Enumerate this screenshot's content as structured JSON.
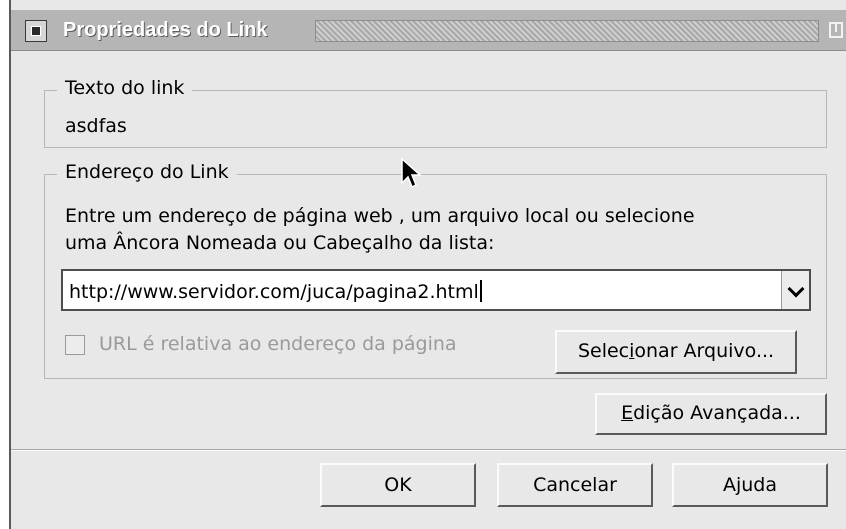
{
  "window": {
    "title": "Propriedades do Link"
  },
  "icons": {
    "menu": "window-menu-icon",
    "maximize": "maximize-icon",
    "dropdown": "chevron-down-icon",
    "cursor": "mouse-cursor-icon"
  },
  "link_text_group": {
    "legend": "Texto do link",
    "value": "asdfas"
  },
  "address_group": {
    "legend": "Endereço do Link",
    "description_line1": "Entre um endereço de página web , um arquivo local ou selecione",
    "description_line2": "uma Âncora Nomeada ou Cabeçalho da lista:",
    "url_value": "http://www.servidor.com/juca/pagina2.html",
    "relative_checkbox": {
      "label": "URL é relativa ao endereço da página",
      "checked": false,
      "disabled": true
    },
    "select_file_button": {
      "before": "Selec",
      "accel": "i",
      "after": "onar Arquivo..."
    }
  },
  "advanced_button": {
    "accel": "E",
    "after": "dição Avançada..."
  },
  "buttons": {
    "ok": "OK",
    "cancel": "Cancelar",
    "help": "Ajuda"
  },
  "colors": {
    "dialog_bg": "#e8e8e8",
    "titlebar_bg": "#b5b5b5",
    "disabled_text": "#9a9a9a"
  }
}
